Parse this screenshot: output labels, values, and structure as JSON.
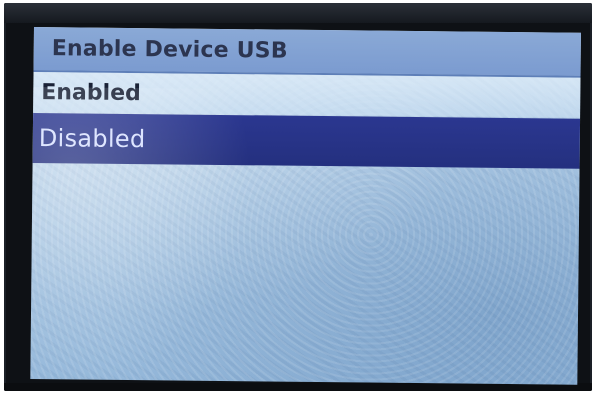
{
  "screen": {
    "title": "Enable Device USB",
    "options": [
      {
        "label": "Enabled",
        "selected": false
      },
      {
        "label": "Disabled",
        "selected": true
      }
    ]
  },
  "colors": {
    "title_bar": "#7b9bd0",
    "selected_row": "#24307f",
    "selected_text": "#d7e0ff",
    "screen_background": "#aac8e4"
  }
}
